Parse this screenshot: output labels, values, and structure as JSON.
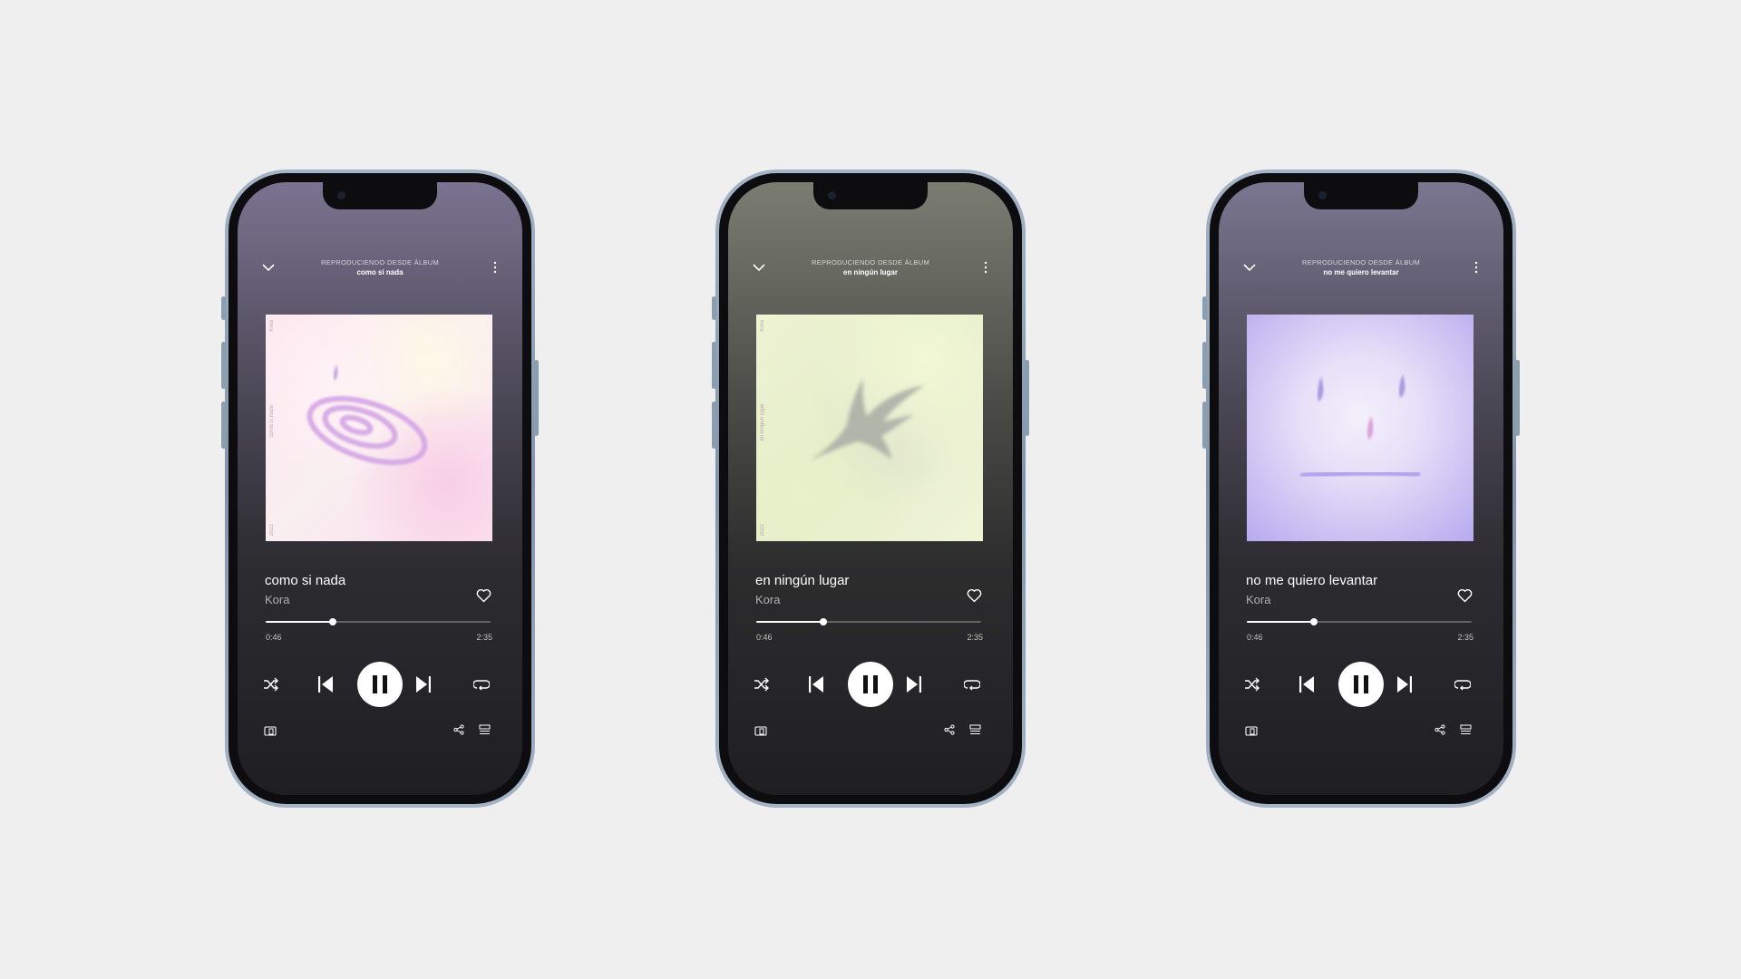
{
  "phones": [
    {
      "header": {
        "from_label": "REPRODUCIENDO DESDE ÁLBUM",
        "album": "como si nada"
      },
      "track": {
        "title": "como si nada",
        "artist": "Kora"
      },
      "cover": {
        "theme": "pink-spiral",
        "side_top": "Kora",
        "side_mid": "como si nada",
        "side_bottom": "2022"
      },
      "progress": {
        "current": "0:46",
        "total": "2:35",
        "fraction": 0.3
      },
      "bg_top": "#7a7390"
    },
    {
      "header": {
        "from_label": "REPRODUCIENDO DESDE ÁLBUM",
        "album": "en ningún lugar"
      },
      "track": {
        "title": "en ningún lugar",
        "artist": "Kora"
      },
      "cover": {
        "theme": "green-star",
        "side_top": "Kora",
        "side_mid": "en ningún lugar",
        "side_bottom": "2022"
      },
      "progress": {
        "current": "0:46",
        "total": "2:35",
        "fraction": 0.3
      },
      "bg_top": "#7b7d72"
    },
    {
      "header": {
        "from_label": "REPRODUCIENDO DESDE ÁLBUM",
        "album": "no me quiero levantar"
      },
      "track": {
        "title": "no me quiero levantar",
        "artist": "Kora"
      },
      "cover": {
        "theme": "lavender-face"
      },
      "progress": {
        "current": "0:46",
        "total": "2:35",
        "fraction": 0.3
      },
      "bg_top": "#7a7690"
    }
  ],
  "icons": {
    "back": "chevron-down-icon",
    "more": "more-vertical-icon",
    "like": "heart-icon",
    "shuffle": "shuffle-icon",
    "prev": "skip-previous-icon",
    "play": "pause-icon",
    "next": "skip-next-icon",
    "repeat": "repeat-icon",
    "devices": "devices-icon",
    "share": "share-icon",
    "queue": "queue-icon"
  }
}
